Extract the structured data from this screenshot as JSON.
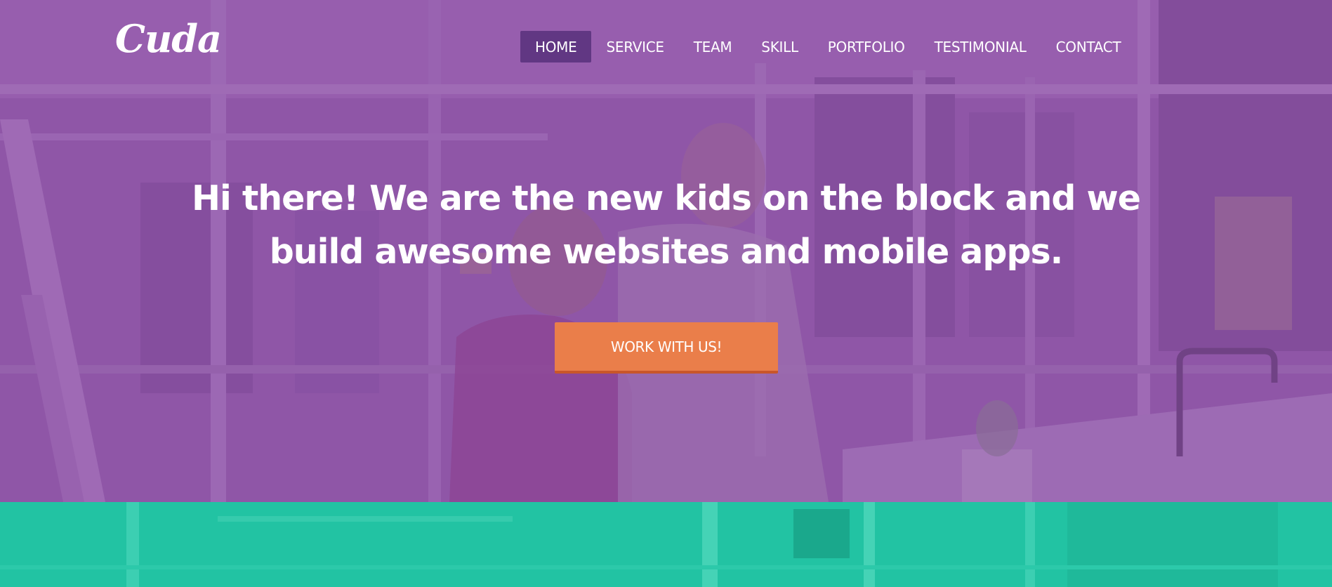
{
  "header": {
    "logo_text": "Cuda",
    "nav": [
      {
        "label": "HOME",
        "active": true
      },
      {
        "label": "SERVICE",
        "active": false
      },
      {
        "label": "TEAM",
        "active": false
      },
      {
        "label": "SKILL",
        "active": false
      },
      {
        "label": "PORTFOLIO",
        "active": false
      },
      {
        "label": "TESTIMONIAL",
        "active": false
      },
      {
        "label": "CONTACT",
        "active": false
      }
    ]
  },
  "hero": {
    "headline": "Hi there! We are the new kids on the block and we build awesome websites and mobile apps.",
    "cta_label": "WORK WITH US!"
  },
  "colors": {
    "hero_overlay": "#9254ac",
    "nav_active_bg": "#613783",
    "cta_bg": "#ea7e4a",
    "strip_bg": "#22c3a3",
    "text": "#ffffff"
  }
}
